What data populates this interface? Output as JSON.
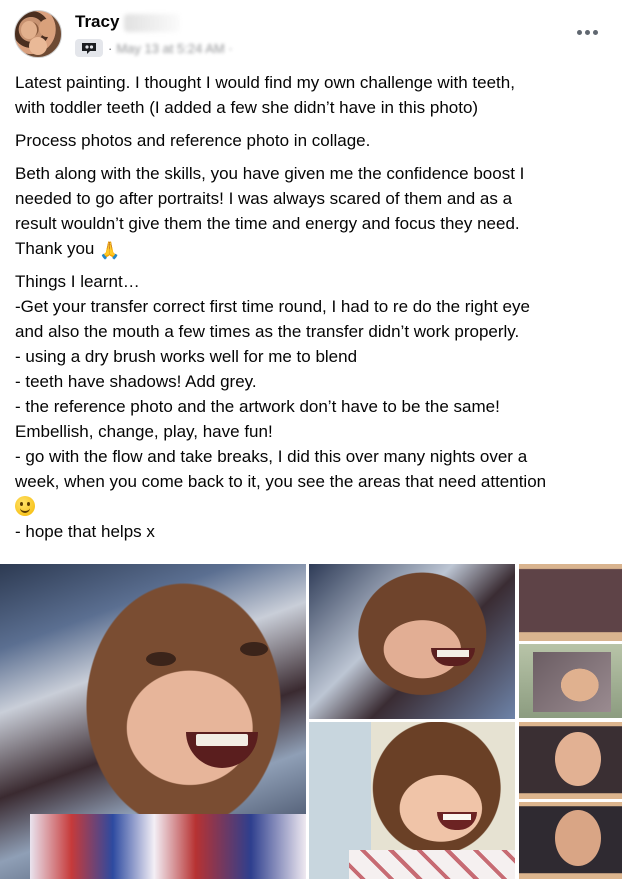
{
  "post": {
    "author_name": "Tracy",
    "time_dot": "·",
    "timestamp": "May 13 at 5:24 AM ·",
    "more_icon": "more-horizontal-icon",
    "group_icon": "group-icon"
  },
  "body": {
    "paragraphs": [
      [
        "Latest painting. I thought I would find my own challenge with teeth,",
        "with toddler teeth (I added a few she didn’t have in this photo)"
      ],
      [
        "Process photos and reference photo in collage."
      ],
      [
        "Beth along with the skills, you have given me the confidence boost I",
        "needed to go after portraits! I was always scared of them and as a",
        "result wouldn’t give them the time and energy and focus they need.",
        "Thank you"
      ],
      [
        "Things I learnt…",
        "-Get your transfer correct first time round, I had to re do the right eye",
        "and also the mouth a few times as the transfer didn’t work properly.",
        "- using a dry brush works well for me to blend",
        "- teeth have shadows! Add grey.",
        "- the reference photo and the artwork don’t have to be the same!",
        "Embellish, change, play, have fun!",
        "- go with the flow and take breaks, I did this over many nights over a",
        "week, when you come back to it, you see the areas that need attention",
        "",
        "- hope that helps x"
      ]
    ],
    "emoji_pray": "🙏",
    "emoji_smile": "smiling-face-emoji"
  },
  "colors": {
    "text": "#050505",
    "meta": "#65676b",
    "icon": "#606770"
  }
}
